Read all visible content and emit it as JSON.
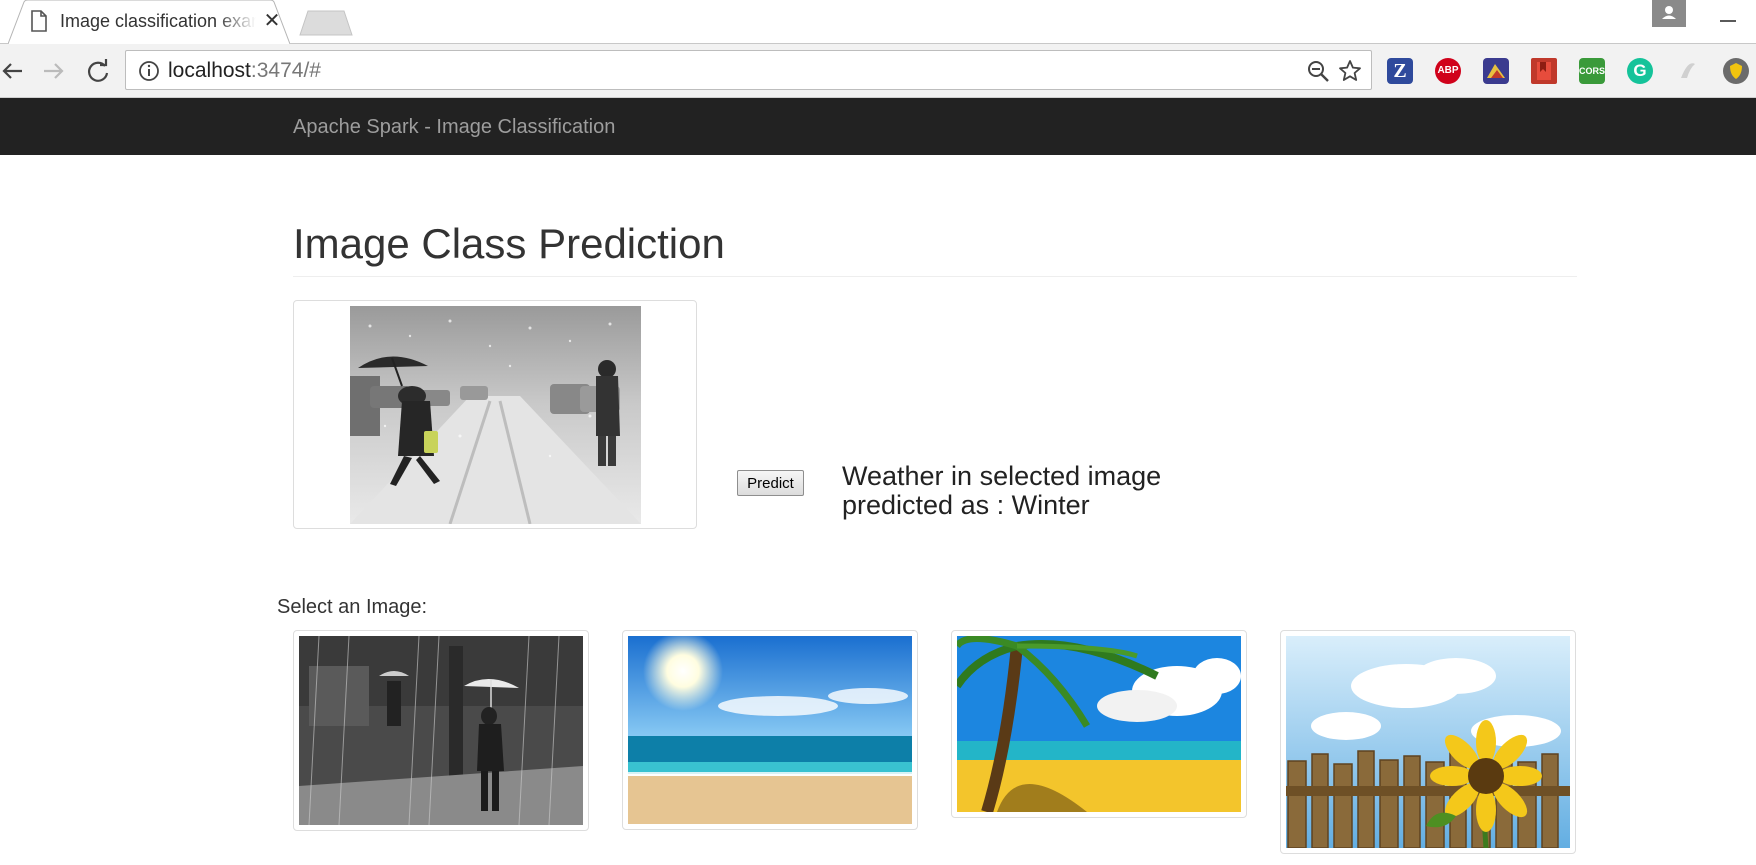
{
  "browser": {
    "tab": {
      "title": "Image classification example"
    },
    "address": {
      "host": "localhost",
      "rest": ":3474/#"
    },
    "extensions": [
      {
        "name": "zotero-icon",
        "text": "Z",
        "color": "#2f4a9c"
      },
      {
        "name": "adblock-plus-icon",
        "text": "ABP",
        "color": "#d0021b"
      },
      {
        "name": "extension-icon",
        "text": "",
        "color": "#3b3b8f"
      },
      {
        "name": "bookmark-extension-icon",
        "text": "",
        "color": "#c0392b"
      },
      {
        "name": "cors-icon",
        "text": "CORS",
        "color": "#3a9a3a"
      },
      {
        "name": "grammarly-icon",
        "text": "G",
        "color": "#15c39a"
      },
      {
        "name": "extension-inactive-icon",
        "text": "",
        "color": "#d0d0d0"
      },
      {
        "name": "shield-extension-icon",
        "text": "",
        "color": "#6b6b6b"
      }
    ]
  },
  "navbar": {
    "brand": "Apache Spark - Image Classification"
  },
  "main": {
    "title": "Image Class Prediction",
    "predict_label": "Predict",
    "result_line1": "Weather in selected image",
    "result_line2": "predicted as : Winter",
    "select_label": "Select an Image:"
  },
  "gallery": [
    {
      "name": "rain"
    },
    {
      "name": "beach"
    },
    {
      "name": "palm-beach"
    },
    {
      "name": "sunflower-fence"
    }
  ]
}
